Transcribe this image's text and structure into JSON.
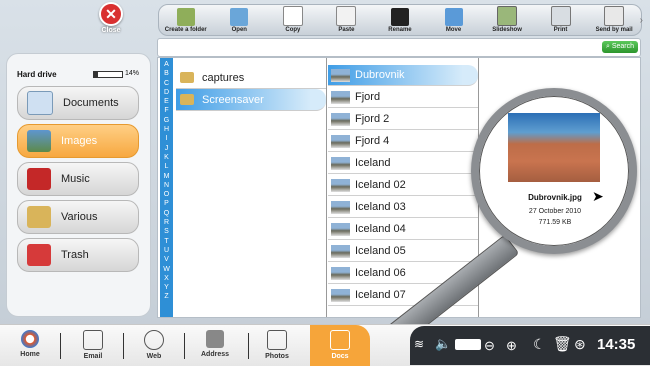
{
  "close": {
    "label": "Close"
  },
  "toolbar": [
    {
      "label": "Create a folder",
      "icon": "new-folder-icon"
    },
    {
      "label": "Open",
      "icon": "open-icon"
    },
    {
      "label": "Copy",
      "icon": "copy-icon"
    },
    {
      "label": "Paste",
      "icon": "paste-icon"
    },
    {
      "label": "Rename",
      "icon": "rename-icon"
    },
    {
      "label": "Move",
      "icon": "move-icon"
    },
    {
      "label": "Slideshow",
      "icon": "slideshow-icon"
    },
    {
      "label": "Print",
      "icon": "print-icon"
    },
    {
      "label": "Send by mail",
      "icon": "mail-icon"
    }
  ],
  "storage": {
    "label": "Hard drive",
    "usage_percent": 14,
    "usage_text": "14%"
  },
  "categories": [
    {
      "label": "Documents",
      "icon": "documents-icon"
    },
    {
      "label": "Images",
      "icon": "images-icon",
      "active": true
    },
    {
      "label": "Music",
      "icon": "music-icon"
    },
    {
      "label": "Various",
      "icon": "folder-icon"
    },
    {
      "label": "Trash",
      "icon": "trash-icon"
    }
  ],
  "search": {
    "button": "Search"
  },
  "alphabet": [
    "A",
    "B",
    "C",
    "D",
    "E",
    "F",
    "G",
    "H",
    "I",
    "J",
    "K",
    "L",
    "M",
    "N",
    "O",
    "P",
    "Q",
    "R",
    "S",
    "T",
    "U",
    "V",
    "W",
    "X",
    "Y",
    "Z"
  ],
  "folders": [
    {
      "name": "captures"
    },
    {
      "name": "Screensaver",
      "selected": true
    }
  ],
  "files": [
    {
      "name": "Dubrovnik",
      "selected": true
    },
    {
      "name": "Fjord"
    },
    {
      "name": "Fjord 2"
    },
    {
      "name": "Fjord 4"
    },
    {
      "name": "Iceland"
    },
    {
      "name": "Iceland 02"
    },
    {
      "name": "Iceland 03"
    },
    {
      "name": "Iceland 04"
    },
    {
      "name": "Iceland 05"
    },
    {
      "name": "Iceland 06"
    },
    {
      "name": "Iceland 07"
    }
  ],
  "preview": {
    "filename": "Dubrovnik.jpg",
    "date": "27 October 2010",
    "size": "771.59 KB"
  },
  "dock": [
    {
      "label": "Home",
      "icon": "home-icon"
    },
    {
      "label": "Email",
      "icon": "email-icon"
    },
    {
      "label": "Web",
      "icon": "web-icon"
    },
    {
      "label": "Address",
      "icon": "address-icon"
    },
    {
      "label": "Photos",
      "icon": "photos-icon"
    },
    {
      "label": "Docs",
      "icon": "docs-icon",
      "active": true
    }
  ],
  "tray": {
    "time": "14:35"
  },
  "colors": {
    "accent": "#f6a53a",
    "selection": "#3f9de6",
    "alphabet_bar": "#2e8fd6"
  }
}
